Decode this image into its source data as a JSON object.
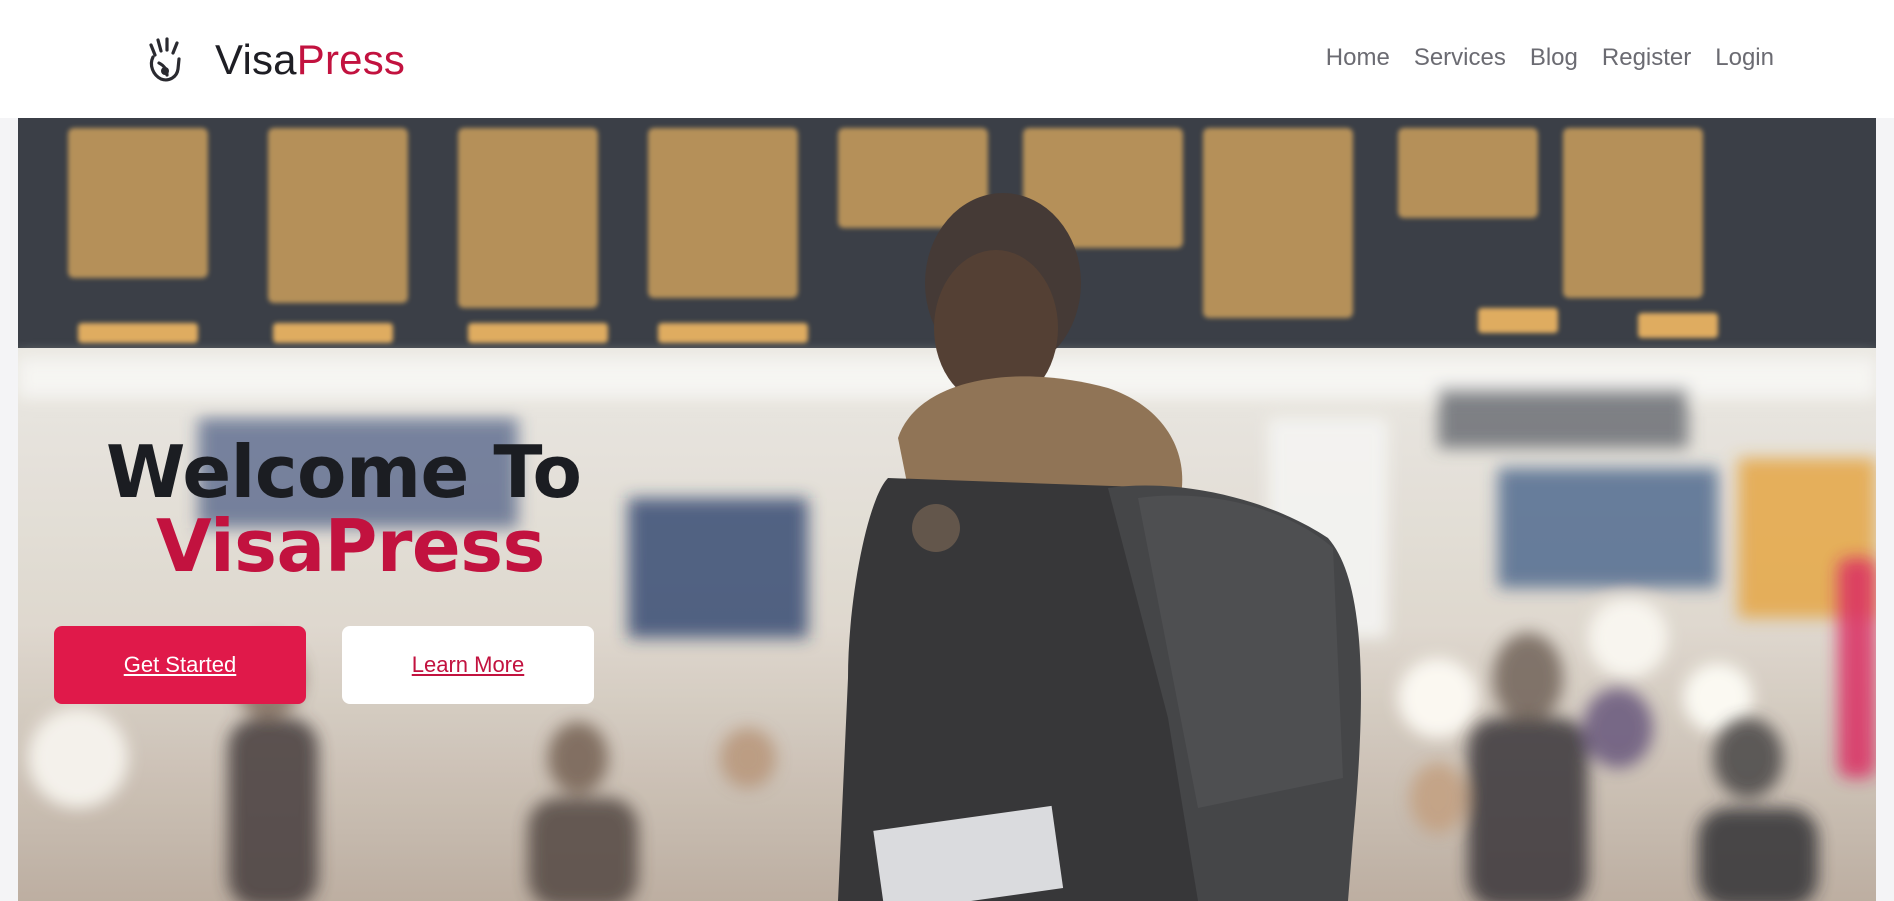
{
  "brand": {
    "icon": "hand-wave-icon",
    "name_part1": "Visa",
    "name_part2": "Press",
    "accent_color": "#c2123f"
  },
  "nav": {
    "items": [
      {
        "label": "Home"
      },
      {
        "label": "Services"
      },
      {
        "label": "Blog"
      },
      {
        "label": "Register"
      },
      {
        "label": "Login"
      }
    ]
  },
  "hero": {
    "title_line1": "Welcome To",
    "title_line2": "VisaPress",
    "primary_button": "Get Started",
    "secondary_button": "Learn More",
    "background_image": "traveler-at-airport-departure-board",
    "primary_color": "#e0194a"
  }
}
